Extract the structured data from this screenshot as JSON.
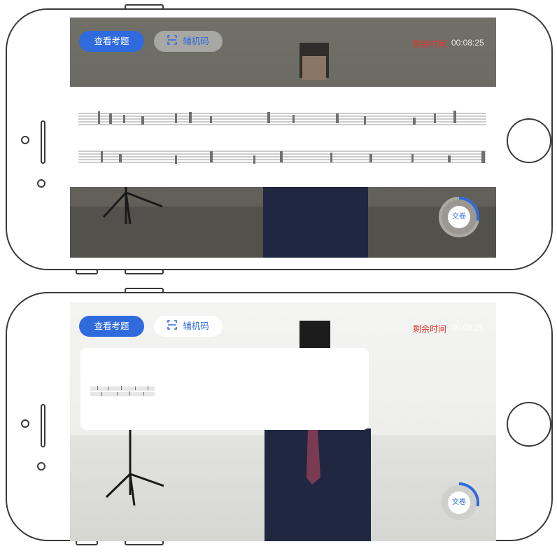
{
  "header": {
    "view_question_label": "查看考题",
    "aux_code_label": "辅机码",
    "time_remaining_label": "剩余时间",
    "time_remaining_value": "00:08:25"
  },
  "submit_label": "交卷",
  "sheet_music_title": "",
  "colors": {
    "accent": "#2f6bdc",
    "timer_label": "#e0372b"
  },
  "progress": 0.28
}
